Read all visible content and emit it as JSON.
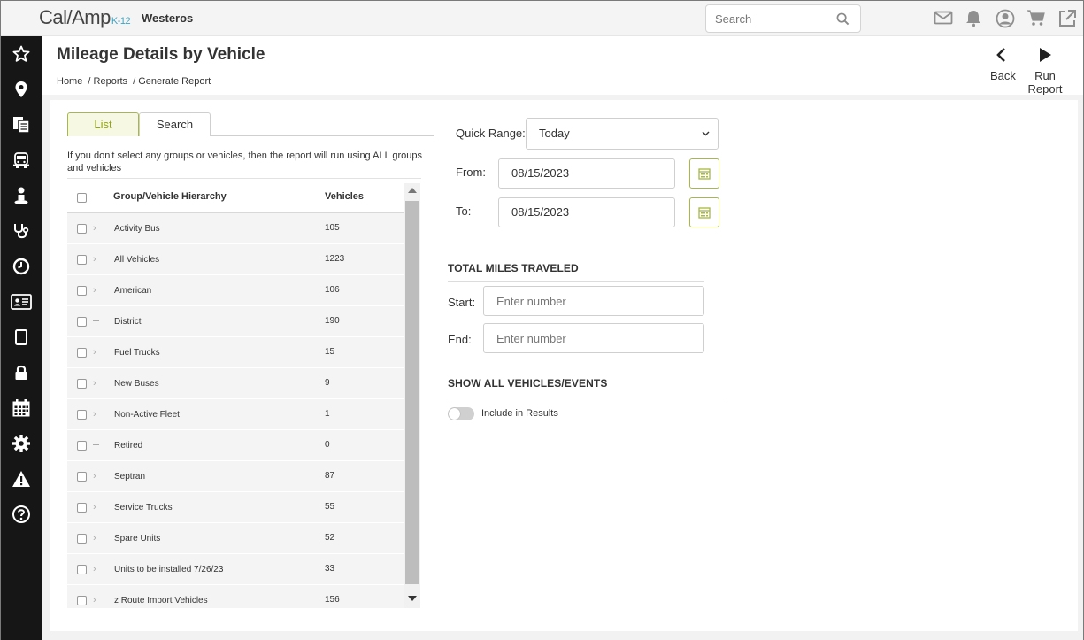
{
  "app": {
    "logo_main": "Cal/Amp",
    "logo_sub": "K-12",
    "org_name": "Westeros"
  },
  "topbar": {
    "search_placeholder": "Search",
    "icons": [
      "mail-icon",
      "bell-icon",
      "user-icon",
      "cart-icon",
      "external-link-icon"
    ]
  },
  "sidenav": {
    "icons": [
      "star-icon",
      "location-pin-icon",
      "documents-icon",
      "bus-icon",
      "driver-icon",
      "stethoscope-icon",
      "clock-icon",
      "id-card-icon",
      "tablet-icon",
      "lock-icon",
      "calendar-icon",
      "gear-icon",
      "warning-icon",
      "help-icon"
    ]
  },
  "header": {
    "title": "Mileage Details by Vehicle",
    "breadcrumb": [
      "Home",
      "/ Reports",
      "/ Generate Report"
    ],
    "back_label": "Back",
    "run_label": "Run Report"
  },
  "tabs": {
    "list_label": "List",
    "search_label": "Search"
  },
  "hint_text": "If you don't select any groups or vehicles, then the report will run using ALL groups and vehicles",
  "table": {
    "col_hierarchy": "Group/Vehicle Hierarchy",
    "col_vehicles": "Vehicles",
    "rows": [
      {
        "name": "Activity Bus",
        "count": "105",
        "expander": "chevron"
      },
      {
        "name": "All Vehicles",
        "count": "1223",
        "expander": "chevron"
      },
      {
        "name": "American",
        "count": "106",
        "expander": "chevron"
      },
      {
        "name": "District",
        "count": "190",
        "expander": "dash"
      },
      {
        "name": "Fuel Trucks",
        "count": "15",
        "expander": "chevron"
      },
      {
        "name": "New Buses",
        "count": "9",
        "expander": "chevron"
      },
      {
        "name": "Non-Active Fleet",
        "count": "1",
        "expander": "chevron"
      },
      {
        "name": "Retired",
        "count": "0",
        "expander": "dash"
      },
      {
        "name": "Septran",
        "count": "87",
        "expander": "chevron"
      },
      {
        "name": "Service Trucks",
        "count": "55",
        "expander": "chevron"
      },
      {
        "name": "Spare Units",
        "count": "52",
        "expander": "chevron"
      },
      {
        "name": "Units to be installed 7/26/23",
        "count": "33",
        "expander": "chevron"
      },
      {
        "name": "z Route Import Vehicles",
        "count": "156",
        "expander": "chevron"
      }
    ]
  },
  "form": {
    "quick_range_label": "Quick Range:",
    "quick_range_value": "Today",
    "from_label": "From:",
    "from_value": "08/15/2023",
    "to_label": "To:",
    "to_value": "08/15/2023",
    "miles_section": "TOTAL MILES TRAVELED",
    "start_label": "Start:",
    "start_placeholder": "Enter number",
    "end_label": "End:",
    "end_placeholder": "Enter number",
    "show_all_section": "SHOW ALL VEHICLES/EVENTS",
    "include_label": "Include in Results",
    "include_on": false
  },
  "colors": {
    "accent": "#a9b843",
    "accent_text": "#93a513",
    "nav_bg": "#161616",
    "logo_sub": "#3aa6c4"
  }
}
